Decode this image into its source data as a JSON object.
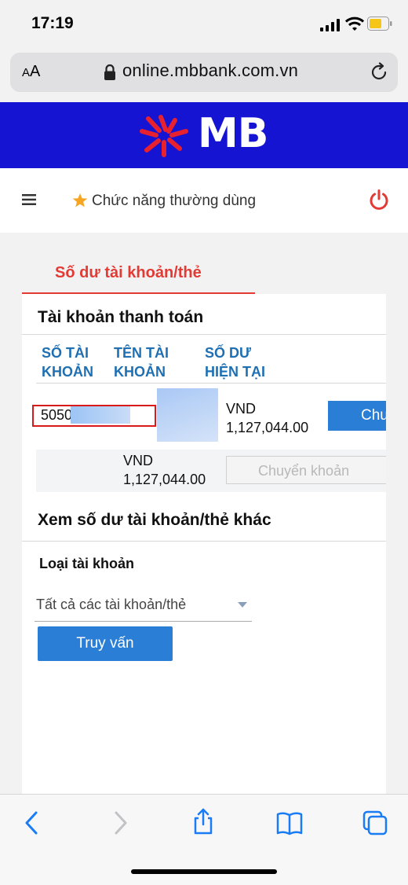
{
  "status_bar": {
    "time": "17:19"
  },
  "browser": {
    "aa_small": "A",
    "aa_large": "A",
    "url": "online.mbbank.com.vn"
  },
  "brand": {
    "logo_text": "MB"
  },
  "nav": {
    "favorites_label": "Chức năng thường dùng"
  },
  "section_tab": "Số dư tài khoản/thẻ",
  "account_card": {
    "title": "Tài khoản thanh toán",
    "headers": [
      {
        "line1": "SỐ TÀI",
        "line2": "KHOẢN"
      },
      {
        "line1": "TÊN TÀI",
        "line2": "KHOẢN"
      },
      {
        "line1": "SỐ DƯ",
        "line2": "HIỆN TẠI"
      }
    ],
    "row1": {
      "account_number": "5050         096",
      "currency": "VND",
      "balance": "1,127,044.00",
      "action": "Chuyển khoản"
    },
    "row2": {
      "currency": "VND",
      "balance": "1,127,044.00",
      "action": "Chuyển khoản"
    }
  },
  "other_balances": {
    "title": "Xem số dư tài khoản/thẻ khác",
    "account_type_label": "Loại tài khoản",
    "account_type_value": "Tất cả các tài khoản/thẻ",
    "query_button": "Truy vấn"
  },
  "colors": {
    "brand_blue": "#1414d2",
    "accent_red": "#e33a34",
    "link_blue": "#1f6fb3",
    "button_blue": "#2a7ed6"
  }
}
